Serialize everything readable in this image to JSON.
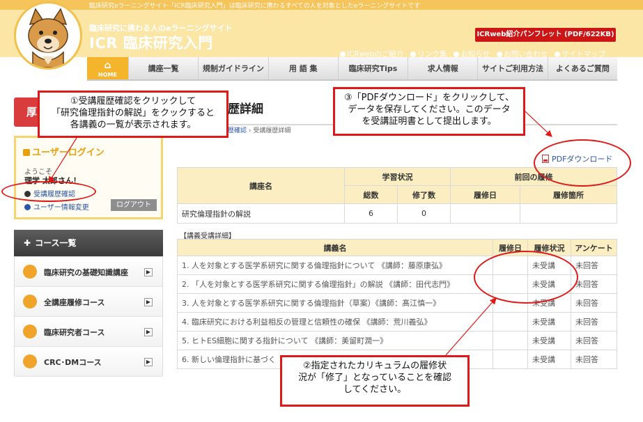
{
  "topbar": {
    "text": "臨床研究eラーニングサイト「ICR臨床研究入門」は臨床研究に携わるすべての人を対象としたeラーニングサイトです"
  },
  "header": {
    "tagline": "臨床研究に携わる人のeラーニングサイト",
    "brand": "ICR 臨床研究入門",
    "pamphlet_button": "ICRweb紹介パンフレット (PDF/622KB)",
    "links": [
      "ICRwebのご紹介",
      "リンク集",
      "お知らせ",
      "お問い合わせ",
      "サイトマップ"
    ]
  },
  "nav": {
    "home": "HOME",
    "items": [
      "講座一覧",
      "規制ガイドライン",
      "用 語 集",
      "臨床研究Tips",
      "求人情報",
      "サイトご利用方法",
      "よくあるご質問"
    ]
  },
  "sidebar": {
    "tab_label": "厚",
    "login": {
      "title": "ユーザーログイン",
      "welcome": "ようこそ",
      "username": "理学 太郎さん！",
      "history_link": "受講履歴確認",
      "info_link": "ユーザー情報変更",
      "logout": "ログアウト"
    },
    "courses": {
      "header": "コース一覧",
      "items": [
        "臨床研究の基礎知識講座",
        "全講座履修コース",
        "臨床研究者コース",
        "CRC･DMコース"
      ]
    }
  },
  "main": {
    "title": "歴詳細",
    "breadcrumb_link": "歴確認",
    "breadcrumb_current": "› 受講履歴詳細",
    "pdf_download": "PDFダウンロード",
    "summary": {
      "col_course": "講座名",
      "col_status": "学習状況",
      "col_total": "総数",
      "col_done": "修了数",
      "col_prev": "前回の履修",
      "col_date": "履修日",
      "col_place": "履修箇所",
      "row": {
        "name": "研究倫理指針の解説",
        "total": "6",
        "done": "0",
        "date": "",
        "place": ""
      }
    },
    "detail_label": "【講義受講詳細】",
    "detail": {
      "col_lecture": "講義名",
      "col_date": "履修日",
      "col_status": "履修状況",
      "col_survey": "アンケート",
      "rows": [
        {
          "name": "1. 人を対象とする医学系研究に関する倫理指針について 《講師：藤原康弘》",
          "date": "",
          "status": "未受講",
          "survey": "未回答"
        },
        {
          "name": "2. 「人を対象とする医学系研究に関する倫理指針」の解説 《講師：田代志門》",
          "date": "",
          "status": "未受講",
          "survey": "未回答"
        },
        {
          "name": "3. 人を対象とする医学系研究に関する倫理指針（草案）《講師：髙江慎一》",
          "date": "",
          "status": "未受講",
          "survey": "未回答"
        },
        {
          "name": "4. 臨床研究における利益相反の管理と信頼性の確保 《講師：荒川義弘》",
          "date": "",
          "status": "未受講",
          "survey": "未回答"
        },
        {
          "name": "5. ヒトES細胞に関する指針について 《講師：美留町潤一》",
          "date": "",
          "status": "未受講",
          "survey": "未回答"
        },
        {
          "name": "6. 新しい倫理指針に基づく",
          "date": "",
          "status": "未受講",
          "survey": "未回答"
        }
      ]
    }
  },
  "annotations": {
    "a1": [
      "①受講履歴確認をクリックして",
      "「研究倫理指針の解説」をクックすると",
      "各講義の一覧が表示されます。"
    ],
    "a3": [
      "③「PDFダウンロード」をクリックして、",
      "データを保存してください。このデータ",
      "を受講証明書として提出します。"
    ],
    "a2": [
      "②指定されたカリキュラムの履修状",
      "況が「修了」となっていることを確認",
      "してください。"
    ],
    "color": "#e01818"
  }
}
